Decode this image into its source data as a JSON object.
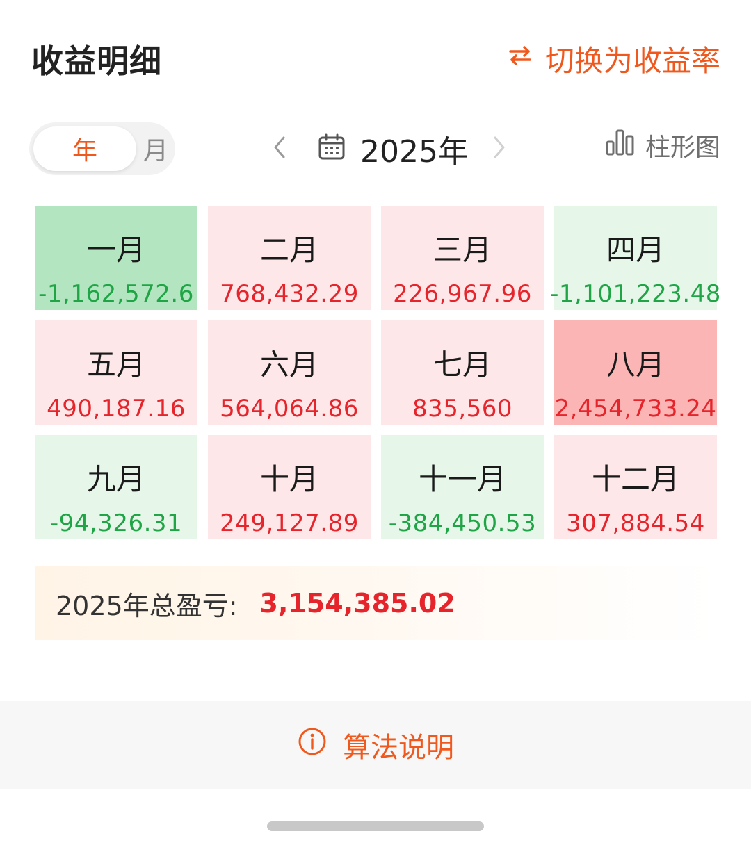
{
  "header": {
    "title": "收益明细",
    "switch_label": "切换为收益率"
  },
  "controls": {
    "seg_year": "年",
    "seg_month": "月",
    "year_label": "2025年",
    "chart_label": "柱形图"
  },
  "months": [
    {
      "name": "一月",
      "value": "-1,162,572.6",
      "sign": "neg",
      "intensity": "strong"
    },
    {
      "name": "二月",
      "value": "768,432.29",
      "sign": "pos",
      "intensity": "light"
    },
    {
      "name": "三月",
      "value": "226,967.96",
      "sign": "pos",
      "intensity": "light"
    },
    {
      "name": "四月",
      "value": "-1,101,223.48",
      "sign": "neg",
      "intensity": "light"
    },
    {
      "name": "五月",
      "value": "490,187.16",
      "sign": "pos",
      "intensity": "light"
    },
    {
      "name": "六月",
      "value": "564,064.86",
      "sign": "pos",
      "intensity": "light"
    },
    {
      "name": "七月",
      "value": "835,560",
      "sign": "pos",
      "intensity": "light"
    },
    {
      "name": "八月",
      "value": "2,454,733.24",
      "sign": "pos",
      "intensity": "strong"
    },
    {
      "name": "九月",
      "value": "-94,326.31",
      "sign": "neg",
      "intensity": "light"
    },
    {
      "name": "十月",
      "value": "249,127.89",
      "sign": "pos",
      "intensity": "light"
    },
    {
      "name": "十一月",
      "value": "-384,450.53",
      "sign": "neg",
      "intensity": "light"
    },
    {
      "name": "十二月",
      "value": "307,884.54",
      "sign": "pos",
      "intensity": "light"
    }
  ],
  "total": {
    "label": "2025年总盈亏:",
    "value": "3,154,385.02"
  },
  "footer": {
    "explain_label": "算法说明"
  },
  "colors": {
    "accent": "#f0591e",
    "profit": "#e5242b",
    "loss": "#1fa446"
  },
  "icons": {
    "switch": "swap-arrows-icon",
    "prev": "chevron-left-icon",
    "next": "chevron-right-icon",
    "calendar": "calendar-icon",
    "chart": "bar-chart-icon",
    "info": "info-icon"
  }
}
